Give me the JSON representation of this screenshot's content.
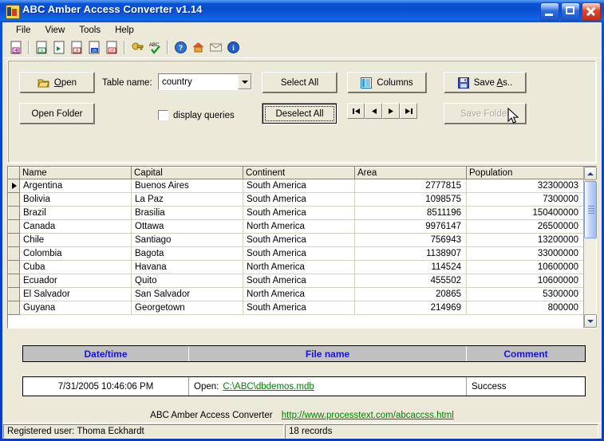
{
  "window": {
    "title": "ABC Amber Access Converter v1.14",
    "icon": "app-icon",
    "minimize_label": "Minimize",
    "maximize_label": "Maximize",
    "close_label": "Close"
  },
  "menu": {
    "items": [
      "File",
      "View",
      "Tools",
      "Help"
    ]
  },
  "toolbar": {
    "icons": [
      "open-document-icon",
      "export-excel-icon",
      "export-doc-icon",
      "export-pdf-icon",
      "export-chm-icon",
      "export-rtf-icon",
      "key-icon",
      "spellcheck-abc-icon",
      "help-icon",
      "home-icon",
      "mail-icon",
      "about-info-icon"
    ]
  },
  "controls": {
    "open_label": "Open",
    "open_accel": "O",
    "open_folder_label": "Open Folder",
    "table_name_label": "Table name:",
    "table_name_value": "country",
    "display_queries_label": "display queries",
    "display_queries_checked": false,
    "select_all_label": "Select All",
    "deselect_all_label": "Deselect All",
    "columns_label": "Columns",
    "save_as_label": "Save As..",
    "save_as_accel": "A",
    "save_folder_label": "Save Folder",
    "save_folder_disabled": true,
    "nav": [
      "first-record",
      "previous-record",
      "next-record",
      "last-record"
    ]
  },
  "grid": {
    "columns": [
      "Name",
      "Capital",
      "Continent",
      "Area",
      "Population"
    ],
    "rows": [
      [
        "Argentina",
        "Buenos Aires",
        "South America",
        "2777815",
        "32300003"
      ],
      [
        "Bolivia",
        "La Paz",
        "South America",
        "1098575",
        "7300000"
      ],
      [
        "Brazil",
        "Brasilia",
        "South America",
        "8511196",
        "150400000"
      ],
      [
        "Canada",
        "Ottawa",
        "North America",
        "9976147",
        "26500000"
      ],
      [
        "Chile",
        "Santiago",
        "South America",
        "756943",
        "13200000"
      ],
      [
        "Colombia",
        "Bagota",
        "South America",
        "1138907",
        "33000000"
      ],
      [
        "Cuba",
        "Havana",
        "North America",
        "114524",
        "10600000"
      ],
      [
        "Ecuador",
        "Quito",
        "South America",
        "455502",
        "10600000"
      ],
      [
        "El Salvador",
        "San Salvador",
        "North America",
        "20865",
        "5300000"
      ],
      [
        "Guyana",
        "Georgetown",
        "South America",
        "214969",
        "800000"
      ]
    ],
    "current_row": 0
  },
  "log": {
    "headers": [
      "Date/time",
      "File name",
      "Comment"
    ],
    "entry": {
      "datetime": "7/31/2005 10:46:06 PM",
      "action": "Open:",
      "file": "C:\\ABC\\dbdemos.mdb",
      "comment": "Success"
    }
  },
  "footer": {
    "product": "ABC Amber Access Converter",
    "url": "http://www.processtext.com/abcaccss.html"
  },
  "status": {
    "user": "Registered user: Thoma Eckhardt",
    "records": "18 records"
  },
  "colors": {
    "face": "#ECE9D8",
    "title_blue": "#0A4CCF",
    "link_green": "#008000",
    "log_header_text": "#1414E0",
    "log_header_bg": "#C0C0C0"
  }
}
